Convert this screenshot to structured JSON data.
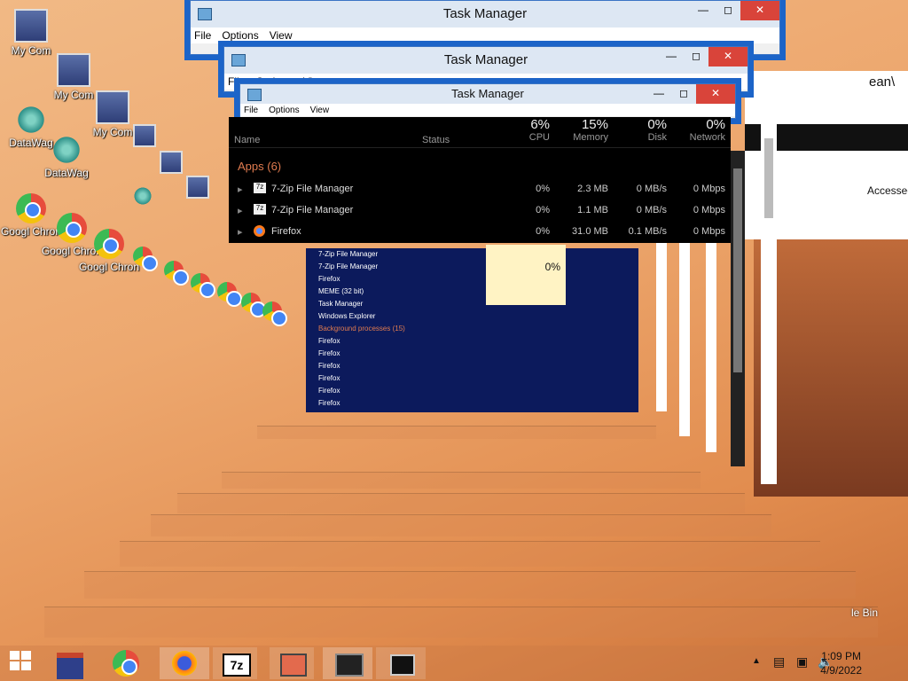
{
  "desktop": {
    "icons": [
      {
        "label": "My Com",
        "icon": "computer-icon"
      },
      {
        "label": "My Com",
        "icon": "computer-icon"
      },
      {
        "label": "My Com",
        "icon": "computer-icon"
      },
      {
        "label": "DataWag",
        "icon": "datawagon-icon"
      },
      {
        "label": "DataWag",
        "icon": "datawagon-icon"
      },
      {
        "label": "Googl Chron",
        "icon": "chrome-icon"
      },
      {
        "label": "Googl Chron",
        "icon": "chrome-icon"
      },
      {
        "label": "Googl Chron",
        "icon": "chrome-icon"
      }
    ]
  },
  "windows": [
    {
      "title": "Task Manager",
      "menu": [
        "File",
        "Options",
        "View"
      ]
    },
    {
      "title": "Task Manager",
      "menu": [
        "File",
        "Options",
        "View"
      ]
    },
    {
      "title": "Task Manager",
      "menu": [
        "File",
        "Options",
        "View"
      ]
    }
  ],
  "task_manager": {
    "columns": {
      "name": "Name",
      "status": "Status",
      "cpu": {
        "pct": "6%",
        "label": "CPU"
      },
      "memory": {
        "pct": "15%",
        "label": "Memory"
      },
      "disk": {
        "pct": "0%",
        "label": "Disk"
      },
      "network": {
        "pct": "0%",
        "label": "Network"
      }
    },
    "group": "Apps (6)",
    "rows": [
      {
        "name": "7-Zip File Manager",
        "cpu": "0%",
        "memory": "2.3 MB",
        "disk": "0 MB/s",
        "network": "0 Mbps",
        "icon": "7zip-icon"
      },
      {
        "name": "7-Zip File Manager",
        "cpu": "0%",
        "memory": "1.1 MB",
        "disk": "0 MB/s",
        "network": "0 Mbps",
        "icon": "7zip-icon"
      },
      {
        "name": "Firefox",
        "cpu": "0%",
        "memory": "31.0 MB",
        "disk": "0.1 MB/s",
        "network": "0 Mbps",
        "icon": "firefox-icon"
      }
    ],
    "cpu_box_value": "0%",
    "background_group": "Background processes (15)",
    "blurred_rows": [
      "7-Zip File Manager",
      "7-Zip File Manager",
      "Firefox",
      "MEME (32 bit)",
      "Task Manager",
      "Windows Explorer",
      "Firefox",
      "Firefox",
      "Firefox",
      "Firefox",
      "Firefox",
      "Firefox"
    ]
  },
  "right_panel": {
    "path_text": "ean\\",
    "accessed_label": "Accessed"
  },
  "taskbar": {
    "time": "1:09 PM",
    "date": "4/9/2022",
    "apps": [
      "start-icon",
      "file-explorer-icon",
      "chrome-icon",
      "firefox-icon",
      "7zip-icon",
      "datawagon-icon",
      "task-manager-icon",
      "terminal-icon"
    ]
  },
  "recycle_bin": {
    "label": "le Bin"
  }
}
